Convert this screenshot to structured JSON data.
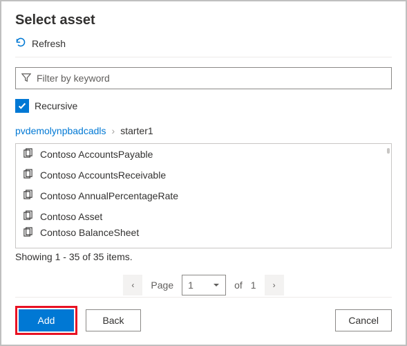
{
  "dialog": {
    "title": "Select asset",
    "refresh_label": "Refresh",
    "filter_placeholder": "Filter by keyword",
    "recursive_label": "Recursive"
  },
  "breadcrumb": {
    "root": "pvdemolynpbadcadls",
    "current": "starter1"
  },
  "assets": [
    {
      "name": "Contoso AccountsPayable"
    },
    {
      "name": "Contoso AccountsReceivable"
    },
    {
      "name": "Contoso AnnualPercentageRate"
    },
    {
      "name": "Contoso Asset"
    },
    {
      "name": "Contoso BalanceSheet"
    }
  ],
  "list_summary": "Showing 1 - 35 of 35 items.",
  "pager": {
    "page_label": "Page",
    "current_page": "1",
    "of_label": "of",
    "total_pages": "1"
  },
  "buttons": {
    "add": "Add",
    "back": "Back",
    "cancel": "Cancel"
  }
}
